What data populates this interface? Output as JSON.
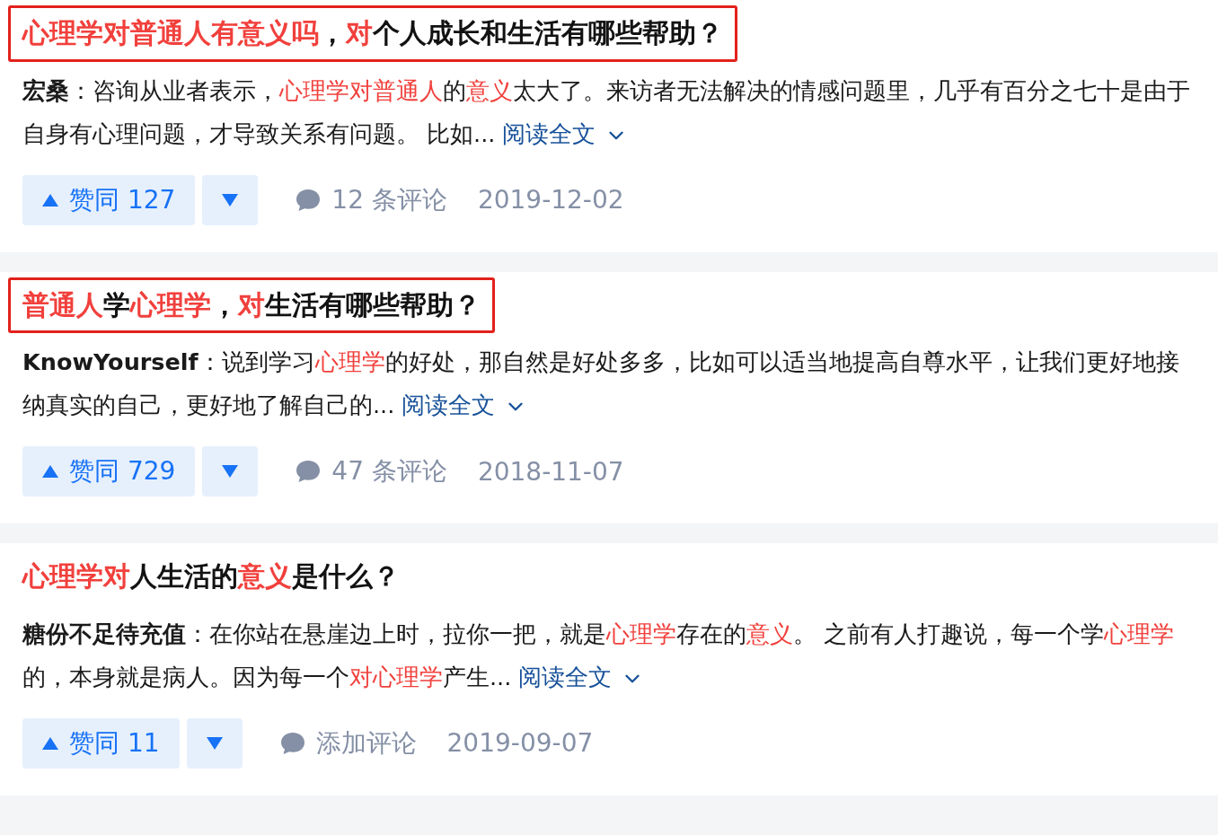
{
  "results": [
    {
      "title_boxed": true,
      "title": [
        {
          "text": "心理学对普通人有意义吗",
          "highlight": true
        },
        {
          "text": "，",
          "highlight": false
        },
        {
          "text": "对",
          "highlight": true
        },
        {
          "text": "个人成长和生活有哪些帮助？",
          "highlight": false
        }
      ],
      "author": "宏桑",
      "excerpt": [
        {
          "text": "：咨询从业者表示，",
          "highlight": false
        },
        {
          "text": "心理学对普通人",
          "highlight": true
        },
        {
          "text": "的",
          "highlight": false
        },
        {
          "text": "意义",
          "highlight": true
        },
        {
          "text": "太大了。来访者无法解决的情感问题里，几乎有百分之七十是由于自身有心理问题，才导致关系有问题。 比如...",
          "highlight": false
        }
      ],
      "read_more": "阅读全文",
      "upvote": "赞同 127",
      "comments": "12 条评论",
      "date": "2019-12-02"
    },
    {
      "title_boxed": true,
      "title": [
        {
          "text": "普通人",
          "highlight": true
        },
        {
          "text": "学",
          "highlight": false
        },
        {
          "text": "心理学",
          "highlight": true
        },
        {
          "text": "，",
          "highlight": false
        },
        {
          "text": "对",
          "highlight": true
        },
        {
          "text": "生活有哪些帮助？",
          "highlight": false
        }
      ],
      "author": "KnowYourself",
      "excerpt": [
        {
          "text": "：说到学习",
          "highlight": false
        },
        {
          "text": "心理学",
          "highlight": true
        },
        {
          "text": "的好处，那自然是好处多多，比如可以适当地提高自尊水平，让我们更好地接纳真实的自己，更好地了解自己的...",
          "highlight": false
        }
      ],
      "read_more": "阅读全文",
      "upvote": "赞同 729",
      "comments": "47 条评论",
      "date": "2018-11-07"
    },
    {
      "title_boxed": false,
      "title": [
        {
          "text": "心理学对",
          "highlight": true
        },
        {
          "text": "人生活的",
          "highlight": false
        },
        {
          "text": "意义",
          "highlight": true
        },
        {
          "text": "是什么？",
          "highlight": false
        }
      ],
      "author": "糖份不足待充值",
      "excerpt": [
        {
          "text": "：在你站在悬崖边上时，拉你一把，就是",
          "highlight": false
        },
        {
          "text": "心理学",
          "highlight": true
        },
        {
          "text": "存在的",
          "highlight": false
        },
        {
          "text": "意义",
          "highlight": true
        },
        {
          "text": "。 之前有人打趣说，每一个学",
          "highlight": false
        },
        {
          "text": "心理学",
          "highlight": true
        },
        {
          "text": "的，本身就是病人。因为每一个",
          "highlight": false
        },
        {
          "text": "对心理学",
          "highlight": true
        },
        {
          "text": "产生...",
          "highlight": false
        }
      ],
      "read_more": "阅读全文",
      "upvote": "赞同 11",
      "comments": "添加评论",
      "date": "2019-09-07"
    }
  ]
}
